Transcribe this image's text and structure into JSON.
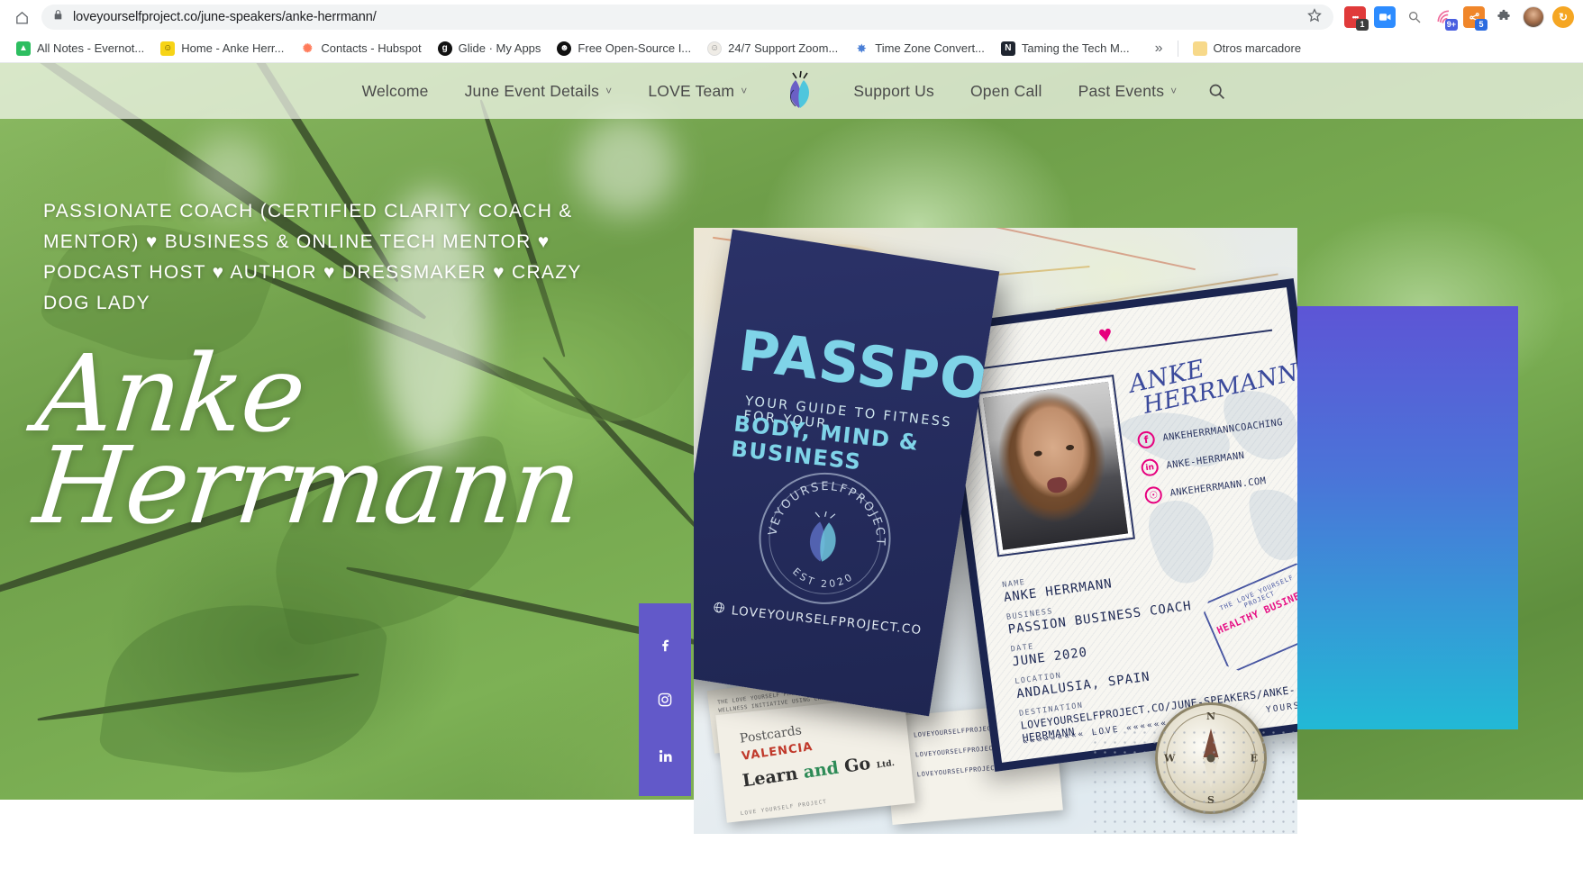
{
  "browser": {
    "url": "loveyourselfproject.co/june-speakers/anke-herrmann/",
    "home_icon": "home-icon",
    "lock_icon": "lock-icon",
    "star_icon": "star-icon",
    "extensions": [
      {
        "name": "ext-red-chat",
        "glyph": "•••",
        "color": "#e03a3a",
        "badge": "1",
        "badge_color": "#3c3c3c"
      },
      {
        "name": "ext-zoom",
        "glyph": "▶",
        "color": "#2d8cff",
        "badge": "",
        "badge_color": ""
      },
      {
        "name": "ext-search-gray",
        "glyph": "@",
        "color": "#8a8a8a",
        "badge": "",
        "badge_color": ""
      },
      {
        "name": "ext-loom",
        "glyph": "◎",
        "color": "#f06a9b",
        "badge": "9+",
        "badge_color": "#4a5fe0"
      },
      {
        "name": "ext-orange-share",
        "glyph": "✲",
        "color": "#f0862a",
        "badge": "5",
        "badge_color": "#2d6cdf"
      },
      {
        "name": "ext-puzzle",
        "glyph": "❖",
        "color": "#5f6368",
        "badge": "",
        "badge_color": ""
      },
      {
        "name": "ext-profile-avatar",
        "glyph": "",
        "color": "#b9845e",
        "badge": "",
        "badge_color": ""
      },
      {
        "name": "ext-orange-circle",
        "glyph": "↻",
        "color": "#f5a623",
        "badge": "",
        "badge_color": ""
      }
    ]
  },
  "bookmarks": {
    "items": [
      {
        "label": "All Notes - Evernot...",
        "icon": "evernote-icon",
        "color": "#2dbe60",
        "glyph": "◢"
      },
      {
        "label": "Home - Anke Herr...",
        "icon": "smiley-icon",
        "color": "#f7d417",
        "glyph": "☺"
      },
      {
        "label": "Contacts - Hubspot",
        "icon": "hubspot-icon",
        "color": "#ff7a59",
        "glyph": "⚙"
      },
      {
        "label": "Glide · My Apps",
        "icon": "glide-icon",
        "color": "#111111",
        "glyph": "g"
      },
      {
        "label": "Free Open-Source I...",
        "icon": "face-icon",
        "color": "#111111",
        "glyph": "☻"
      },
      {
        "label": "24/7 Support Zoom...",
        "icon": "support-icon",
        "color": "#e7e3dc",
        "glyph": "◌"
      },
      {
        "label": "Time Zone Convert...",
        "icon": "timezone-icon",
        "color": "#ffffff",
        "glyph": "✽"
      },
      {
        "label": "Taming the Tech M...",
        "icon": "notion-icon",
        "color": "#1f2530",
        "glyph": "N"
      }
    ],
    "overflow_label": "»",
    "other_bookmarks": {
      "label": "Otros marcadore",
      "icon": "folder-icon",
      "color": "#f7d98a"
    }
  },
  "site_nav": {
    "items": [
      {
        "label": "Welcome",
        "has_caret": false
      },
      {
        "label": "June Event Details",
        "has_caret": true
      },
      {
        "label": "LOVE Team",
        "has_caret": true
      }
    ],
    "logo_name": "leaf-logo",
    "items_right": [
      {
        "label": "Support Us",
        "has_caret": false
      },
      {
        "label": "Open Call",
        "has_caret": false
      },
      {
        "label": "Past Events",
        "has_caret": true
      }
    ],
    "search_icon": "search-icon",
    "caret_glyph": "˅"
  },
  "hero": {
    "tagline": "PASSIONATE COACH (CERTIFIED CLARITY COACH & MENTOR) ♥ BUSINESS & ONLINE TECH MENTOR ♥ PODCAST HOST ♥ AUTHOR ♥ DRESSMAKER ♥ CRAZY DOG LADY",
    "name_line1": "Anke",
    "name_line2": "Herrmann"
  },
  "social_rail": {
    "accent_color": "#6259c9",
    "items": [
      {
        "name": "facebook-icon",
        "glyph": "f"
      },
      {
        "name": "instagram-icon",
        "glyph": "▢"
      },
      {
        "name": "linkedin-icon",
        "glyph": "in"
      }
    ]
  },
  "passport": {
    "cover": {
      "title": "PASSPORT",
      "subtitle_line1": "YOUR GUIDE TO FITNESS FOR YOUR",
      "subtitle_line2": "BODY, MIND & BUSINESS",
      "seal_text": "#LOVEYOURSELFPROJECTVLC",
      "seal_est": "EST 2020",
      "url": "LOVEYOURSELFPROJECT.CO",
      "url_icon": "globe-icon",
      "cover_color": "#262d5f",
      "accent_color": "#7fd4e8"
    },
    "id_page": {
      "heart_icon": "heart-icon",
      "signature_line1": "ANKE",
      "signature_line2": "HERRMANN",
      "photo_name": "passport-photo",
      "socials": [
        {
          "icon": "facebook-icon",
          "glyph": "f",
          "handle": "ANKEHERRMANNCOACHING"
        },
        {
          "icon": "linkedin-icon",
          "glyph": "in",
          "handle": "ANKE-HERRMANN"
        },
        {
          "icon": "globe-icon",
          "glyph": "⊕",
          "handle": "ANKEHERRMANN.COM"
        }
      ],
      "fields": [
        {
          "label": "NAME",
          "value": "ANKE HERRMANN",
          "small": false
        },
        {
          "label": "BUSINESS",
          "value": "PASSION BUSINESS COACH",
          "small": false
        },
        {
          "label": "DATE",
          "value": "JUNE 2020",
          "small": false
        },
        {
          "label": "LOCATION",
          "value": "ANDALUSIA, SPAIN",
          "small": false
        },
        {
          "label": "DESTINATION",
          "value": "LOVEYOURSELFPROJECT.CO/JUNE-SPEAKERS/ANKE-HERRMANN",
          "small": true
        }
      ],
      "footer_left": "««««««««« LOVE «««««««««",
      "footer_right": "YOURSELF",
      "stamp_top": "THE LOVE YOURSELF PROJECT",
      "stamp_text": "HEALTHY BUSINESS",
      "stamp_color": "#e6007e"
    },
    "postcards": {
      "card_a": {
        "pre": "Postcards",
        "title": "VALENCIA",
        "subtitle_a": "Learn",
        "subtitle_and": "and",
        "subtitle_b": "Go",
        "subtitle_tail": "Ltd.",
        "footer": "LOVE  YOURSELF  PROJECT"
      },
      "card_b": {
        "rows": [
          {
            "icon": "facebook-icon",
            "glyph": "f",
            "text": "LOVEYOURSELFPROJECTVLC"
          },
          {
            "icon": "instagram-icon",
            "glyph": "▢",
            "text": "LOVEYOURSELFPROJECTVLC"
          },
          {
            "icon": "globe-icon",
            "glyph": "⊕",
            "text": "LOVEYOURSELFPROJECT.CO"
          }
        ]
      },
      "card_c": {
        "text": "THE LOVE YOURSELF PROJECT IS A COMMUNITY AND WELLNESS INITIATIVE USING CHANGE TECHNIQUES FOR A HEALTHIER LIFE"
      }
    },
    "compass": {
      "n": "N",
      "e": "E",
      "s": "S",
      "w": "W",
      "name": "compass-rose"
    }
  }
}
